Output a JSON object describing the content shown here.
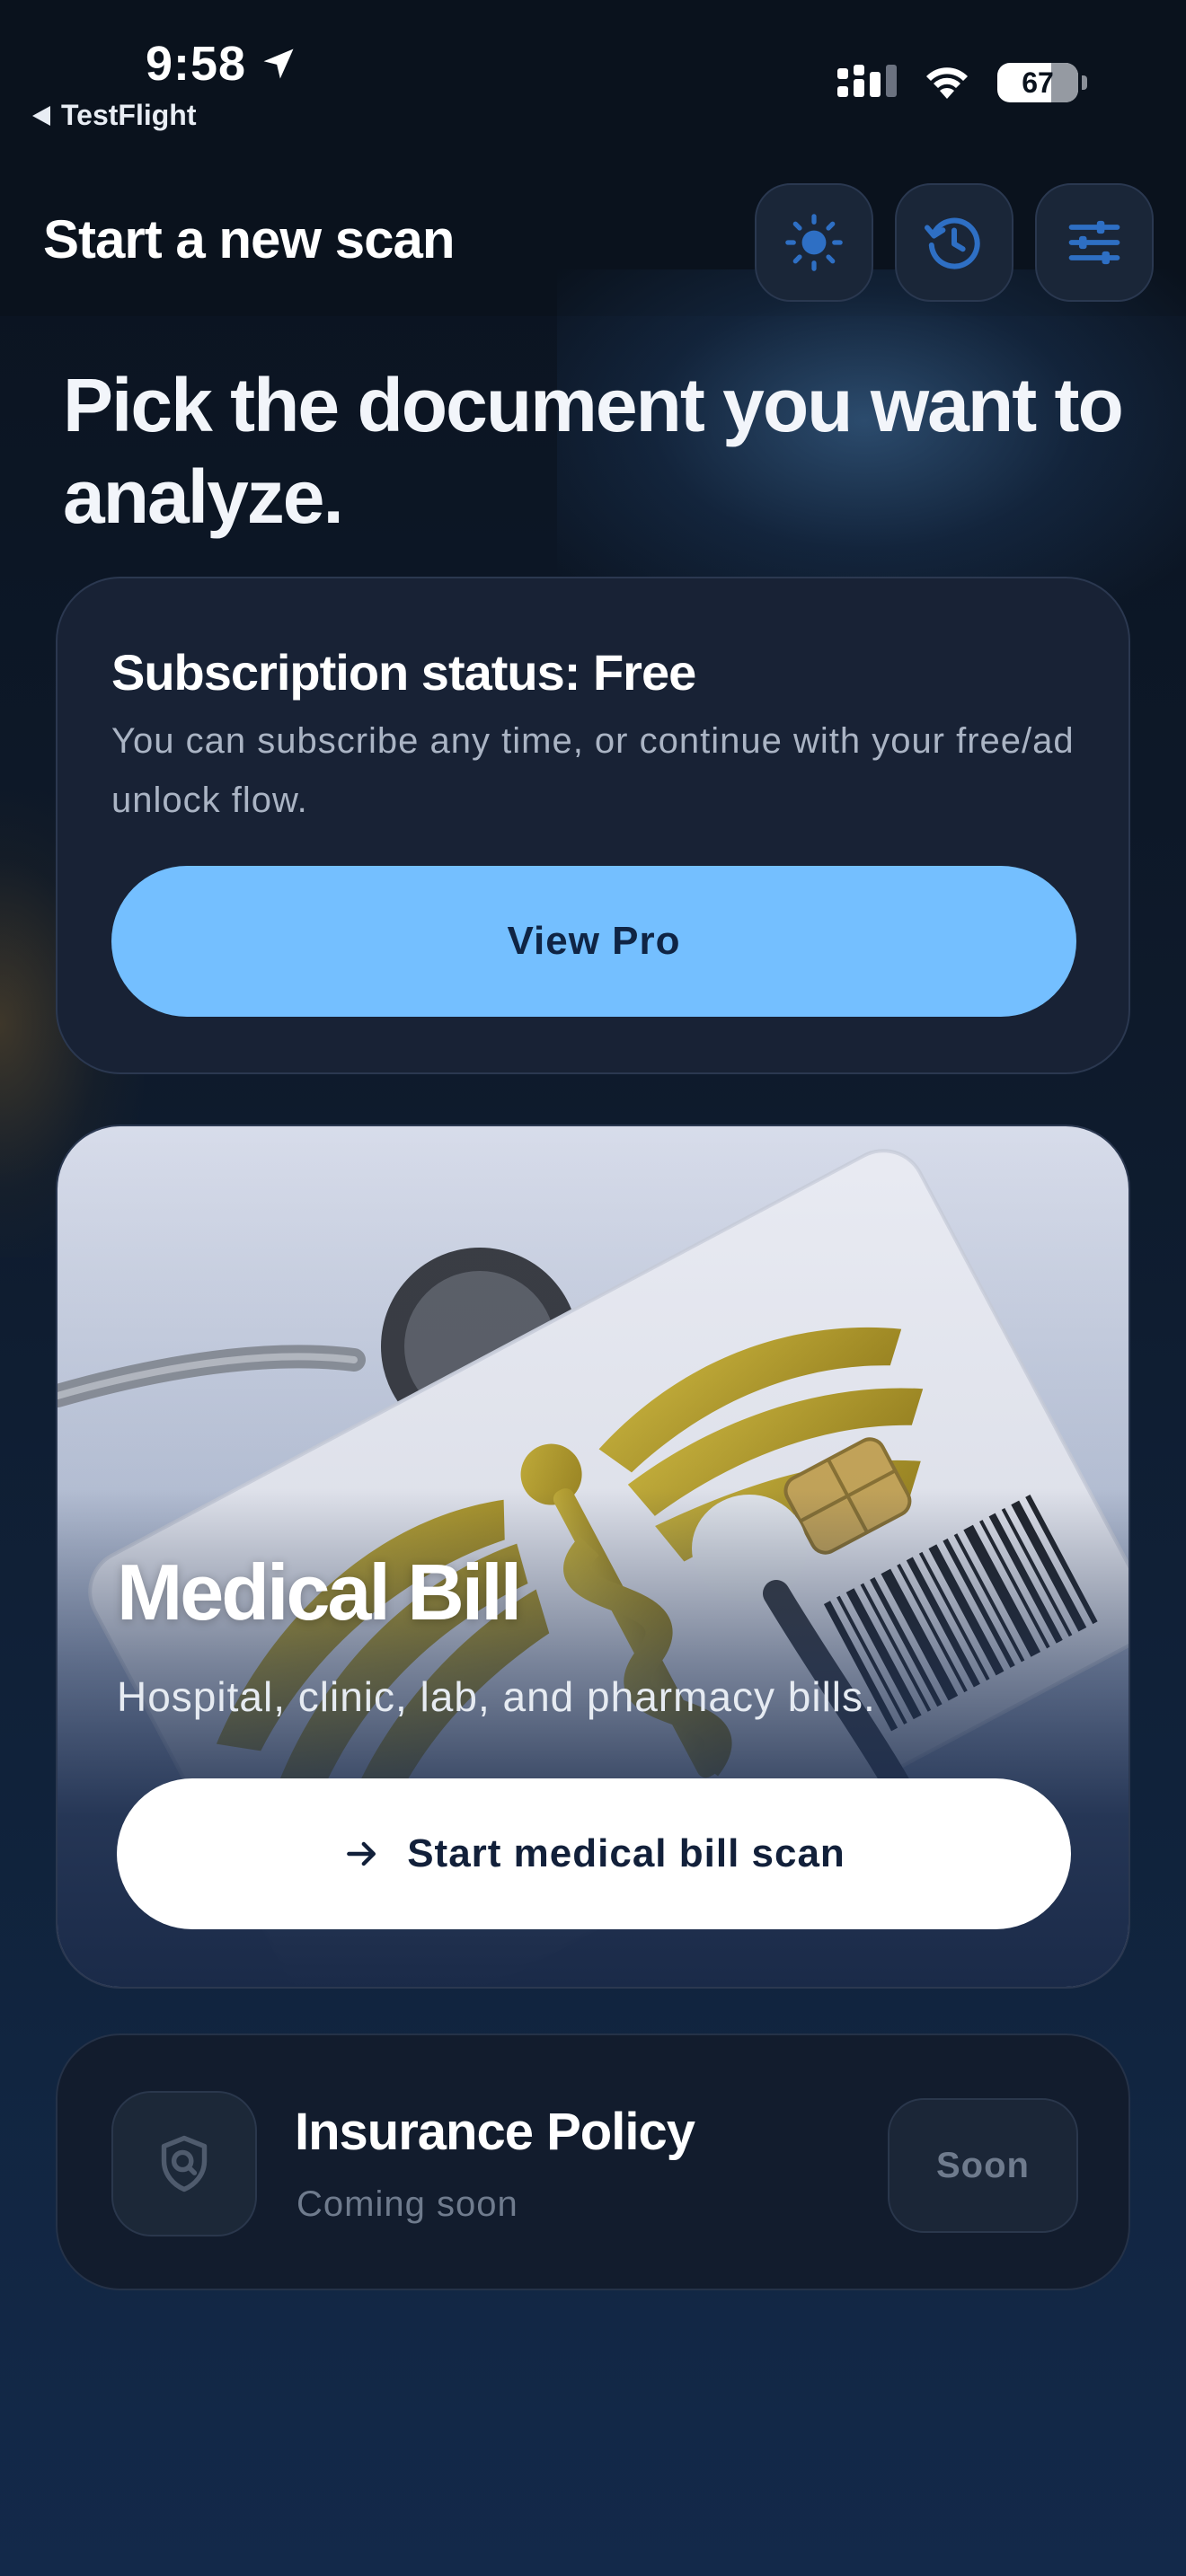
{
  "status_bar": {
    "time": "9:58",
    "back_app": "TestFlight",
    "battery": "67"
  },
  "top_bar": {
    "title": "Start a new scan",
    "buttons": [
      "sun-icon",
      "history-icon",
      "sliders-icon"
    ]
  },
  "headline": "Pick the document you want to analyze.",
  "subscription": {
    "title": "Subscription status: Free",
    "description": "You can subscribe any time, or continue with your free/ad unlock flow.",
    "button_label": "View Pro"
  },
  "medical_card": {
    "title": "Medical Bill",
    "subtitle": "Hospital, clinic, lab, and pharmacy bills.",
    "button_label": "Start medical bill scan",
    "button_icon": "arrow-right-icon"
  },
  "insurance_card": {
    "title": "Insurance Policy",
    "subtitle": "Coming soon",
    "badge_label": "Soon",
    "icon": "shield-search-icon"
  },
  "colors": {
    "accent": "#74bfff",
    "background": "#0b1220",
    "card": "#182235",
    "icon_blue": "#2e6fc4"
  }
}
